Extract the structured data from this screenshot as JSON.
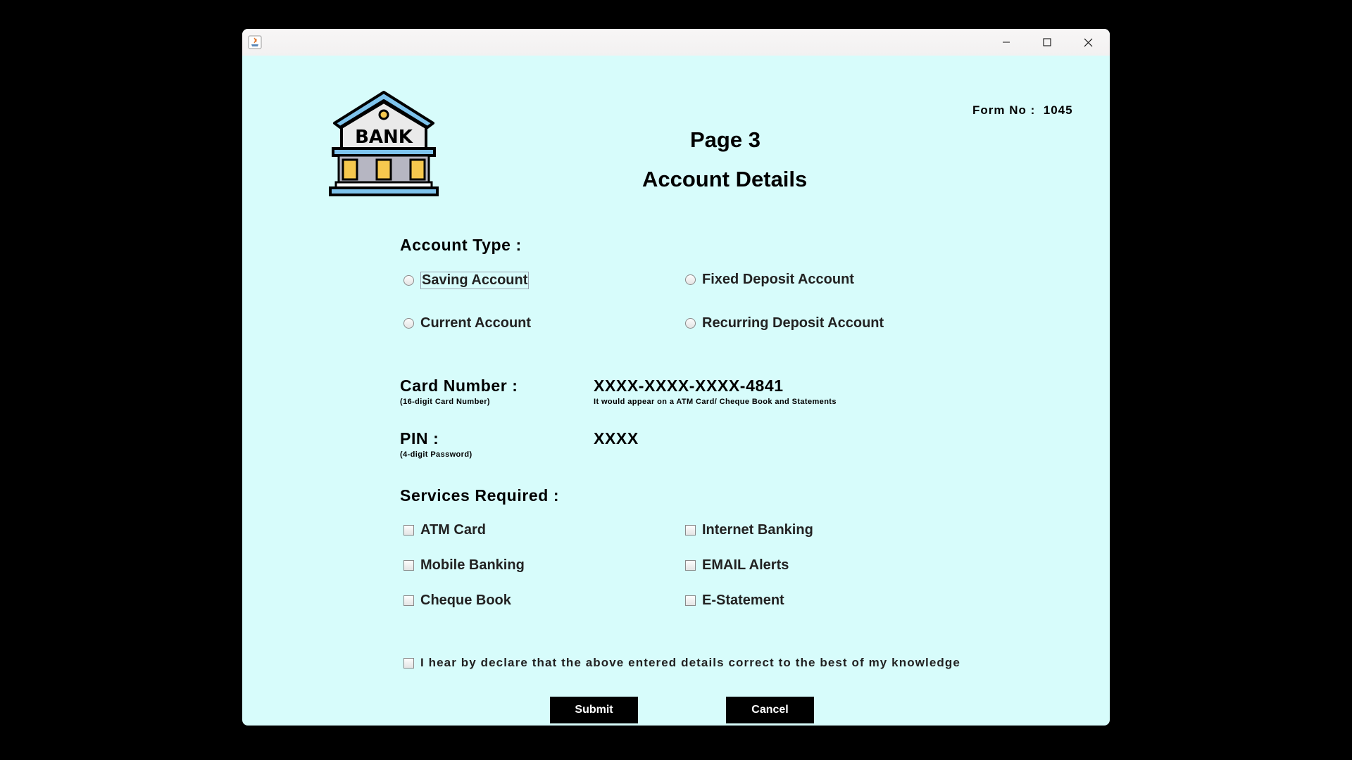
{
  "window": {
    "controls": [
      "minimize-icon",
      "maximize-icon",
      "close-icon"
    ]
  },
  "header": {
    "form_no_label": "Form No :",
    "form_no_value": "1045",
    "page": "Page 3",
    "title": "Account Details",
    "logo_text": "BANK"
  },
  "account_type": {
    "label": "Account Type :",
    "options": [
      "Saving Account",
      "Fixed Deposit Account",
      "Current Account",
      "Recurring Deposit Account"
    ],
    "selected": "none"
  },
  "card": {
    "label": "Card Number :",
    "hint": "(16-digit Card Number)",
    "value": "XXXX-XXXX-XXXX-4841",
    "note": "It would appear on a ATM Card/ Cheque Book and Statements"
  },
  "pin": {
    "label": "PIN :",
    "hint": "(4-digit Password)",
    "value": "XXXX"
  },
  "services": {
    "label": "Services Required :",
    "options": [
      "ATM Card",
      "Internet Banking",
      "Mobile Banking",
      "EMAIL Alerts",
      "Cheque Book",
      "E-Statement"
    ]
  },
  "declaration": "I hear by declare that the above entered details correct to the best of my knowledge",
  "buttons": {
    "submit": "Submit",
    "cancel": "Cancel"
  },
  "colors": {
    "background": "#d7fcfb",
    "button": "#000000",
    "logo_accent": "#7ec3ec"
  }
}
